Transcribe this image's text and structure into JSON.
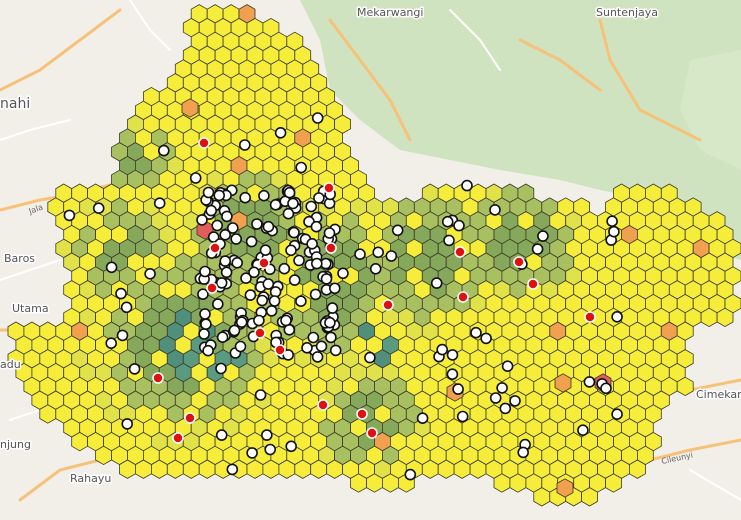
{
  "map": {
    "place_labels": [
      {
        "name": "Mekarwangi"
      },
      {
        "name": "Suntenjaya"
      },
      {
        "name": "nahi"
      },
      {
        "name": "Baros"
      },
      {
        "name": "Utama"
      },
      {
        "name": "njung"
      },
      {
        "name": "Rahayu"
      },
      {
        "name": "Cimekar"
      },
      {
        "name": "adu"
      }
    ],
    "road_labels": [
      "Jala",
      "Cileunyi"
    ],
    "colors": {
      "background": "#f2efe9",
      "forest": "#cfe3c0",
      "road_major": "#f6c27a",
      "road_minor": "#ffffff",
      "hex_outline": "#3a3a2a",
      "bin_low": "#f5ed3a",
      "bin_mid_low": "#e1e14a",
      "bin_green": "#a9c060",
      "bin_green_dark": "#86a85a",
      "bin_teal": "#4f8f7c",
      "bin_orange": "#f0a04e",
      "bin_red": "#e25c5c",
      "point_white": "#ffffff",
      "point_red": "#dd1111",
      "point_stroke": "#111111"
    },
    "layers": [
      "basemap-terrain",
      "hexbin-density",
      "point-markers"
    ]
  }
}
